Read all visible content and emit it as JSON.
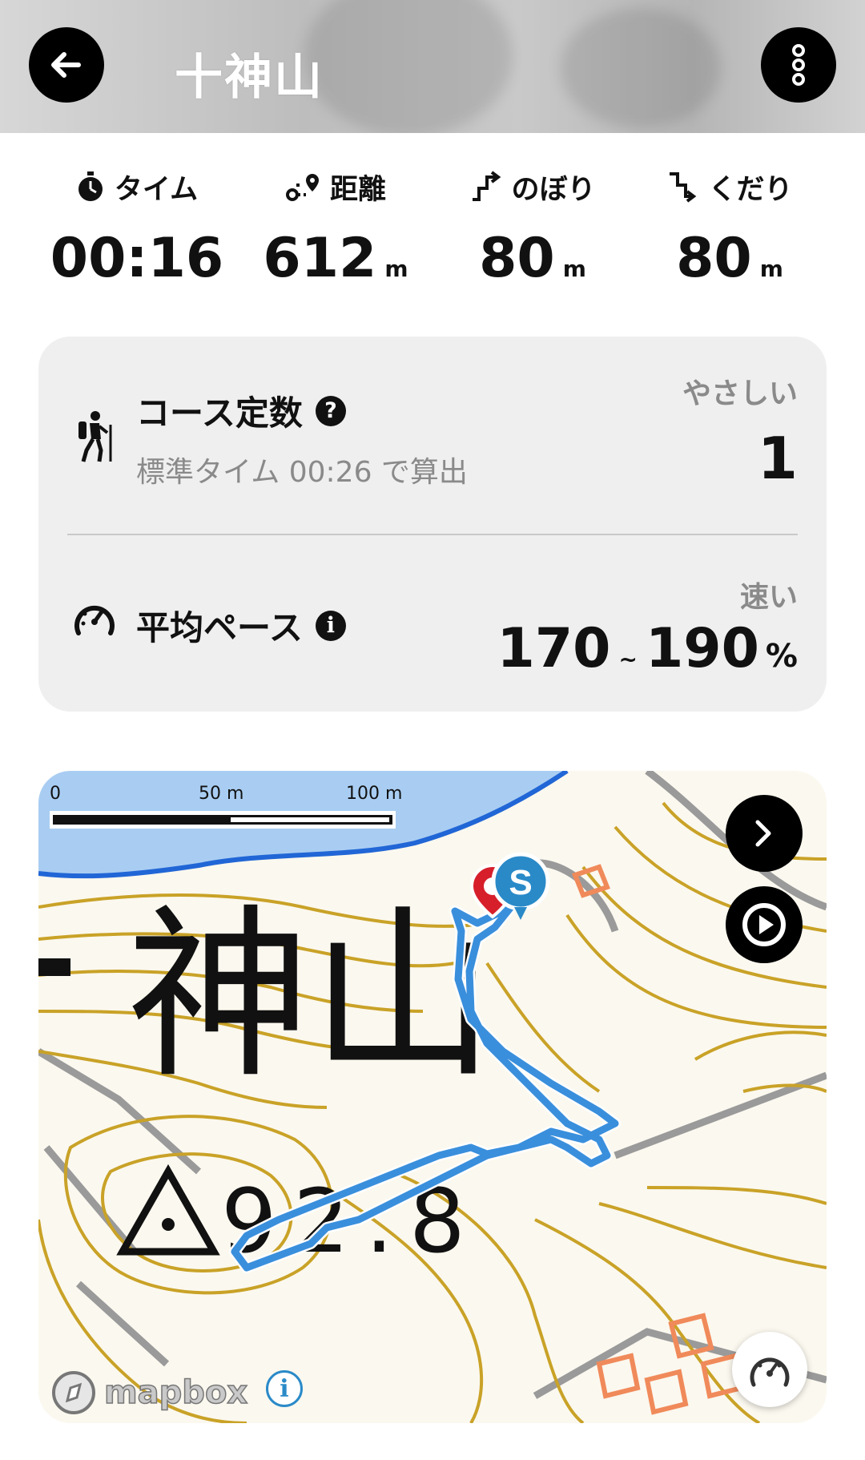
{
  "header": {
    "title": "十神山",
    "back_icon": "arrow-left-icon",
    "menu_icon": "more-vertical-icon"
  },
  "stats": [
    {
      "icon": "stopwatch-icon",
      "label": "タイム",
      "value": "00:16",
      "unit": ""
    },
    {
      "icon": "route-icon",
      "label": "距離",
      "value": "612",
      "unit": "m"
    },
    {
      "icon": "ascent-icon",
      "label": "のぼり",
      "value": "80",
      "unit": "m"
    },
    {
      "icon": "descent-icon",
      "label": "くだり",
      "value": "80",
      "unit": "m"
    }
  ],
  "course": {
    "icon": "hiker-icon",
    "title": "コース定数",
    "help_icon": "help-icon",
    "help_glyph": "?",
    "subtitle": "標準タイム 00:26 で算出",
    "difficulty_label": "やさしい",
    "value": "1"
  },
  "pace": {
    "icon": "speedometer-icon",
    "title": "平均ペース",
    "info_icon": "info-icon",
    "info_glyph": "i",
    "speed_label": "速い",
    "value_low": "170",
    "separator": "~",
    "value_high": "190",
    "unit": "%"
  },
  "map": {
    "scale_labels": [
      "0",
      "50 m",
      "100 m"
    ],
    "map_label_mountain": "神山",
    "map_label_elevation": "92.8",
    "start_marker_letter": "S",
    "attribution": "mapbox",
    "attribution_info_glyph": "i",
    "colors": {
      "route": "#3a8fdc",
      "contour": "#c9a227",
      "water": "#a9cdf2",
      "road": "#9a9a9a"
    }
  }
}
